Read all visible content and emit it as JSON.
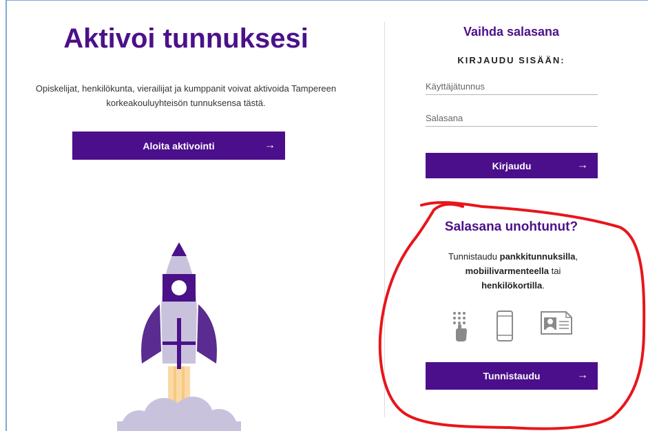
{
  "left": {
    "title": "Aktivoi tunnuksesi",
    "intro_line1": "Opiskelijat, henkilökunta, vierailijat ja kumppanit voivat aktivoida Tampereen",
    "intro_line2": "korkeakouluyhteisön tunnuksensa tästä.",
    "activate_button": "Aloita aktivointi",
    "arrow": "→"
  },
  "right": {
    "title": "Vaihda salasana",
    "login_heading": "KIRJAUDU SISÄÄN:",
    "username_placeholder": "Käyttäjätunnus",
    "password_placeholder": "Salasana",
    "login_button": "Kirjaudu",
    "arrow": "→"
  },
  "forgot": {
    "title": "Salasana unohtunut?",
    "text_part1": "Tunnistaudu ",
    "text_bold1": "pankkitunnuksilla",
    "text_part2": ",",
    "text_bold2": "mobiilivarmenteella",
    "text_part3": " tai",
    "text_bold3": "henkilökortilla",
    "text_part4": ".",
    "icons": [
      "bank-keypad-icon",
      "mobile-phone-icon",
      "id-card-icon"
    ],
    "identify_button": "Tunnistaudu",
    "arrow": "→"
  },
  "colors": {
    "brand_purple": "#4b0f8b",
    "annotation_red": "#e8151b"
  }
}
